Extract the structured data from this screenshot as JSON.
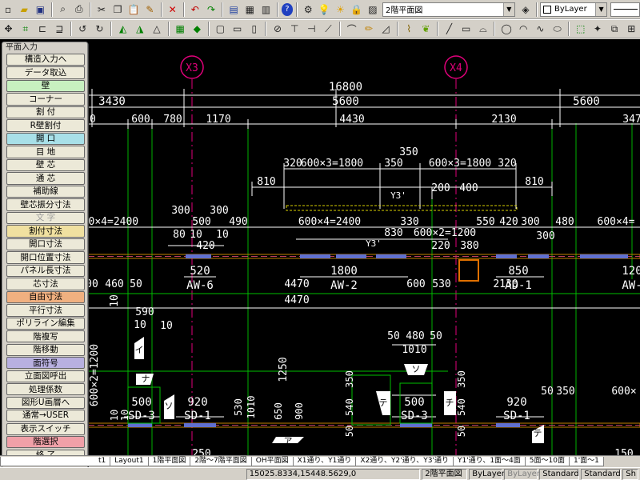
{
  "toolbar": {
    "view_combo": "2階平面図",
    "layer_combo": "ByLayer"
  },
  "palette": {
    "title": "平面入力",
    "buttons": [
      {
        "label": "構造入力へ",
        "bg": "#ece9d8",
        "enabled": true
      },
      {
        "label": "データ取込",
        "bg": "#ece9d8",
        "enabled": true
      },
      {
        "label": "壁",
        "bg": "#c8f0c0",
        "enabled": true
      },
      {
        "label": "コーナー",
        "bg": "#ece9d8",
        "enabled": true
      },
      {
        "label": "割 付",
        "bg": "#ece9d8",
        "enabled": true
      },
      {
        "label": "R壁割付",
        "bg": "#ece9d8",
        "enabled": true
      },
      {
        "label": "開 口",
        "bg": "#a8e0e8",
        "enabled": true
      },
      {
        "label": "目 地",
        "bg": "#ece9d8",
        "enabled": true
      },
      {
        "label": "壁 芯",
        "bg": "#ece9d8",
        "enabled": true
      },
      {
        "label": "通 芯",
        "bg": "#ece9d8",
        "enabled": true
      },
      {
        "label": "補助線",
        "bg": "#ece9d8",
        "enabled": true
      },
      {
        "label": "壁芯振分寸法",
        "bg": "#ece9d8",
        "enabled": true
      },
      {
        "label": "文 字",
        "bg": "#ece9d8",
        "enabled": false
      },
      {
        "label": "割付寸法",
        "bg": "#f0e0a0",
        "enabled": true
      },
      {
        "label": "開口寸法",
        "bg": "#ece9d8",
        "enabled": true
      },
      {
        "label": "開口位置寸法",
        "bg": "#ece9d8",
        "enabled": true
      },
      {
        "label": "パネル長寸法",
        "bg": "#ece9d8",
        "enabled": true
      },
      {
        "label": "芯寸法",
        "bg": "#ece9d8",
        "enabled": true
      },
      {
        "label": "自由寸法",
        "bg": "#f0b080",
        "enabled": true
      },
      {
        "label": "平行寸法",
        "bg": "#ece9d8",
        "enabled": true
      },
      {
        "label": "ポリライン編集",
        "bg": "#ece9d8",
        "enabled": true
      },
      {
        "label": "階複写",
        "bg": "#ece9d8",
        "enabled": true
      },
      {
        "label": "階移動",
        "bg": "#ece9d8",
        "enabled": true
      },
      {
        "label": "面符号",
        "bg": "#b8b0e0",
        "enabled": true
      },
      {
        "label": "立面図呼出",
        "bg": "#ece9d8",
        "enabled": true
      },
      {
        "label": "処理係数",
        "bg": "#ece9d8",
        "enabled": true
      },
      {
        "label": "図形U画層へ",
        "bg": "#ece9d8",
        "enabled": true
      },
      {
        "label": "通常→USER",
        "bg": "#ece9d8",
        "enabled": true
      },
      {
        "label": "表示スイッチ",
        "bg": "#ece9d8",
        "enabled": true
      },
      {
        "label": "階選択",
        "bg": "#f0a0a8",
        "enabled": true
      },
      {
        "label": "終 了",
        "bg": "#ece9d8",
        "enabled": true
      }
    ]
  },
  "drawing": {
    "axes": [
      {
        "label": "X3"
      },
      {
        "label": "X4"
      }
    ],
    "total_dim": "16800",
    "span_dims": [
      "3430",
      "5600",
      "5600"
    ],
    "row1_dims": [
      "600",
      "780",
      "1170",
      "4430",
      "2130",
      "347"
    ],
    "row1_lead": "0",
    "mid_dims": [
      "320",
      "600×3=1800",
      "350",
      "600×3=1800",
      "320"
    ],
    "mid_350": "350",
    "dims_810": [
      "810",
      "810"
    ],
    "dims_200_400": [
      "200",
      "400"
    ],
    "y3_tags": [
      "Y3'",
      "Y3'"
    ],
    "row3_dims": [
      "300",
      "300",
      "500",
      "490",
      "600×4=2400",
      "330",
      "550",
      "420",
      "300",
      "480",
      "600×4="
    ],
    "row3_lead": "600×4=2400",
    "row3b_dims": [
      "80",
      "420",
      "10",
      "10",
      "830",
      "600×2=1200",
      "220",
      "380",
      "300"
    ],
    "wall_labels": [
      {
        "dim": "520",
        "name": "AW-6"
      },
      {
        "dim": "1800",
        "name": "AW-2"
      },
      {
        "dim": "850",
        "name": "AD-1"
      },
      {
        "dim": "120",
        "name": "AW-"
      }
    ],
    "row5_dims": [
      "00",
      "460",
      "50",
      "4470",
      "600",
      "530",
      "2130"
    ],
    "left_dims": [
      "10",
      "590",
      "10",
      "10"
    ],
    "vert_dims": [
      "600×2=1200",
      "1250"
    ],
    "sd_labels": [
      {
        "dim": "500",
        "name": "SD-3"
      },
      {
        "dim": "920",
        "name": "SD-1"
      },
      {
        "dim": "500",
        "name": "SD-3"
      },
      {
        "dim": "920",
        "name": "SD-1"
      }
    ],
    "bottom_dims": [
      "50",
      "480",
      "50",
      "1010",
      "50",
      "350",
      "600×"
    ],
    "lower_vert": [
      "530",
      "1010",
      "650",
      "900",
      "540",
      "350",
      "50",
      "540",
      "350",
      "50",
      "10",
      "10"
    ],
    "door_tags": [
      "イ",
      "ナ",
      "ソ",
      "テ",
      "チ",
      "ア",
      "ソ",
      "テ"
    ],
    "bottom_edge": [
      "250",
      "150"
    ]
  },
  "tabs": [
    "t1",
    "Layout1",
    "1階平面図",
    "2階〜7階平面図",
    "OH平面図",
    "X1通り、Y1通り",
    "X2通り、Y2'通り、Y3'通り",
    "Y1'通り、1面〜4面",
    "5面〜10面",
    "1'面〜1"
  ],
  "status": {
    "coords": "15025.8334,15448.5629,0",
    "view": "2階平面図",
    "layer1": "ByLayer",
    "layer2": "ByLayer",
    "style1": "Standard",
    "style2": "Standard",
    "style3": "Sh"
  }
}
